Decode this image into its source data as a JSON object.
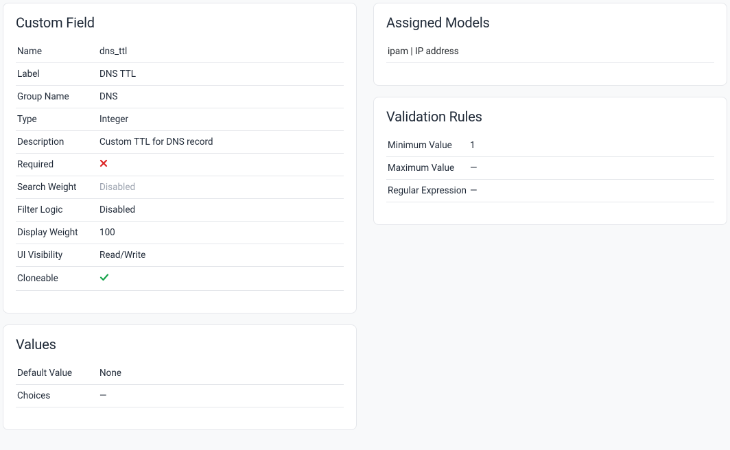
{
  "customField": {
    "title": "Custom Field",
    "rows": {
      "name": {
        "label": "Name",
        "value": "dns_ttl"
      },
      "label": {
        "label": "Label",
        "value": "DNS TTL"
      },
      "groupName": {
        "label": "Group Name",
        "value": "DNS"
      },
      "type": {
        "label": "Type",
        "value": "Integer"
      },
      "description": {
        "label": "Description",
        "value": "Custom TTL for DNS record"
      },
      "required": {
        "label": "Required",
        "value": false
      },
      "searchWeight": {
        "label": "Search Weight",
        "value": "Disabled",
        "muted": true
      },
      "filterLogic": {
        "label": "Filter Logic",
        "value": "Disabled"
      },
      "displayWeight": {
        "label": "Display Weight",
        "value": "100"
      },
      "uiVisibility": {
        "label": "UI Visibility",
        "value": "Read/Write"
      },
      "cloneable": {
        "label": "Cloneable",
        "value": true
      }
    }
  },
  "values": {
    "title": "Values",
    "rows": {
      "defaultValue": {
        "label": "Default Value",
        "value": "None"
      },
      "choices": {
        "label": "Choices",
        "value": "—"
      }
    }
  },
  "assignedModels": {
    "title": "Assigned Models",
    "items": [
      "ipam | IP address"
    ]
  },
  "validationRules": {
    "title": "Validation Rules",
    "rows": {
      "minValue": {
        "label": "Minimum Value",
        "value": "1"
      },
      "maxValue": {
        "label": "Maximum Value",
        "value": "—"
      },
      "regex": {
        "label": "Regular Expression",
        "value": "—"
      }
    }
  }
}
